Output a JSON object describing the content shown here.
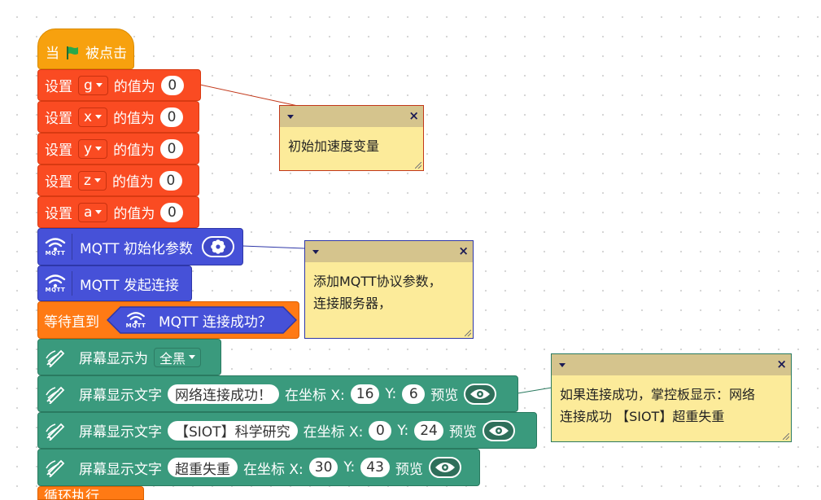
{
  "hat": {
    "when": "当",
    "clicked": "被点击"
  },
  "set_blocks": [
    {
      "set": "设置",
      "var": "g",
      "value_of": "的值为",
      "value": "0"
    },
    {
      "set": "设置",
      "var": "x",
      "value_of": "的值为",
      "value": "0"
    },
    {
      "set": "设置",
      "var": "y",
      "value_of": "的值为",
      "value": "0"
    },
    {
      "set": "设置",
      "var": "z",
      "value_of": "的值为",
      "value": "0"
    },
    {
      "set": "设置",
      "var": "a",
      "value_of": "的值为",
      "value": "0"
    }
  ],
  "mqtt_icon_label": "MQTT",
  "mqtt_init": "MQTT 初始化参数",
  "mqtt_connect": "MQTT 发起连接",
  "wait_block": {
    "label": "等待直到",
    "condition": "MQTT 连接成功？"
  },
  "screen_fill": {
    "label": "屏幕显示为",
    "option": "全黑"
  },
  "text_blocks": [
    {
      "label": "屏幕显示文字",
      "text": "网络连接成功！",
      "at": "在坐标 X:",
      "x": "16",
      "ylabel": "Y:",
      "y": "6",
      "preview": "预览"
    },
    {
      "label": "屏幕显示文字",
      "text": "【SIOT】科学研究",
      "at": "在坐标 X:",
      "x": "0",
      "ylabel": "Y:",
      "y": "24",
      "preview": "预览"
    },
    {
      "label": "屏幕显示文字",
      "text": "超重失重",
      "at": "在坐标 X:",
      "x": "30",
      "ylabel": "Y:",
      "y": "43",
      "preview": "预览"
    }
  ],
  "loop_block": "循环执行",
  "comments": [
    {
      "text": "初始加速度变量"
    },
    {
      "text": "添加MQTT协议参数，\n连接服务器，"
    },
    {
      "text": "如果连接成功，掌控板显示：网络\n连接成功 【SIOT】超重失重"
    }
  ],
  "colors": {
    "event": "#f7a10e",
    "variable": "#fa4b22",
    "mqtt": "#4651d8",
    "control": "#ff7a14",
    "display": "#3a9a7d",
    "comment_bg": "#fceb9a",
    "comment_bar": "#d5c48d",
    "flag": "#2aa84a"
  },
  "icons": {
    "flag": "green-flag-icon",
    "wifi": "wifi-icon",
    "gear": "gear-icon",
    "pen": "pen-icon",
    "eye": "eye-icon"
  }
}
